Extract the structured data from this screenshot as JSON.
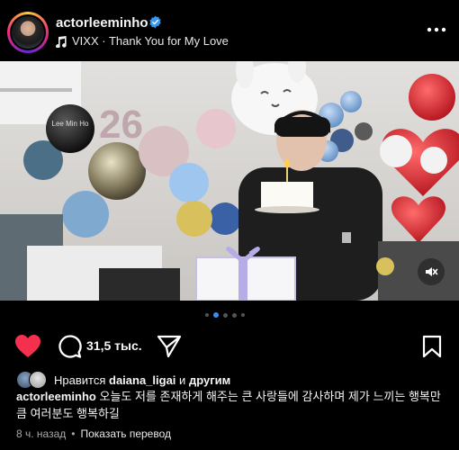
{
  "post": {
    "username": "actorleeminho",
    "music": "VIXX · Thank You for My Love"
  },
  "actions": {
    "comment_count": "31,5 тыс."
  },
  "likes": {
    "prefix": "Нравится",
    "user": "daiana_ligai",
    "middle": "и",
    "suffix": "другим"
  },
  "caption": {
    "username": "actorleeminho",
    "text": "오늘도 저를 존재하게 해주는 큰 사랑들에 감사하며 제가 느끼는 행복만큼 여러분도 행복하길"
  },
  "meta": {
    "time": "8 ч. назад",
    "translate": "Показать перевод"
  },
  "photo": {
    "balloon_text": "2​6"
  },
  "icons": [
    "verified-icon",
    "music-note-icon",
    "more-icon",
    "heart-icon",
    "comment-icon",
    "share-icon",
    "save-icon",
    "mute-icon"
  ],
  "colors": {
    "like": "#f5304f",
    "verified": "#3897f0",
    "active_dot": "#3b8cf5"
  }
}
